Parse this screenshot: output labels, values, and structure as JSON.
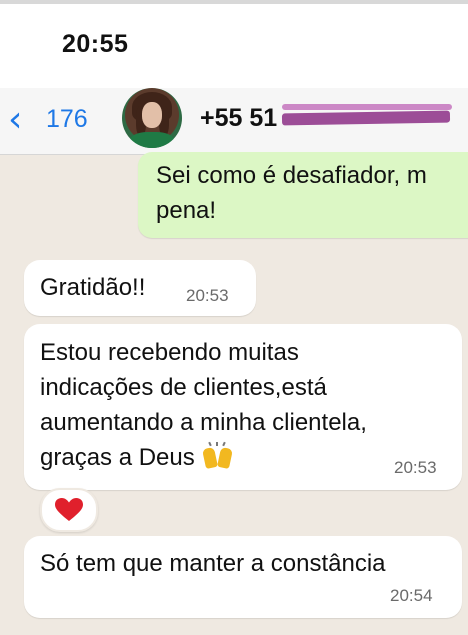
{
  "status_bar": {
    "time": "20:55"
  },
  "header": {
    "back_count": "176",
    "contact_name": "+55 51 ",
    "contact_redacted": true
  },
  "messages": [
    {
      "direction": "outgoing",
      "text": "Sei como é desafiador, m\npena!"
    },
    {
      "direction": "incoming",
      "text": "Gratidão!!",
      "time": "20:53"
    },
    {
      "direction": "incoming",
      "text": "Estou recebendo muitas\nindicações de clientes,está\naumentando a minha clientela,\ngraças a Deus",
      "emoji": "raising-hands-icon",
      "time": "20:53",
      "reaction": "heart-icon"
    },
    {
      "direction": "incoming",
      "text": "Só tem que manter a constância",
      "time": "20:54"
    }
  ],
  "colors": {
    "chat_background": "#efe9e1",
    "outgoing_bubble": "#dcf7c5",
    "incoming_bubble": "#ffffff",
    "accent_blue": "#1e78e6",
    "redaction": "#8c2f86",
    "reaction_heart": "#e0202c"
  }
}
